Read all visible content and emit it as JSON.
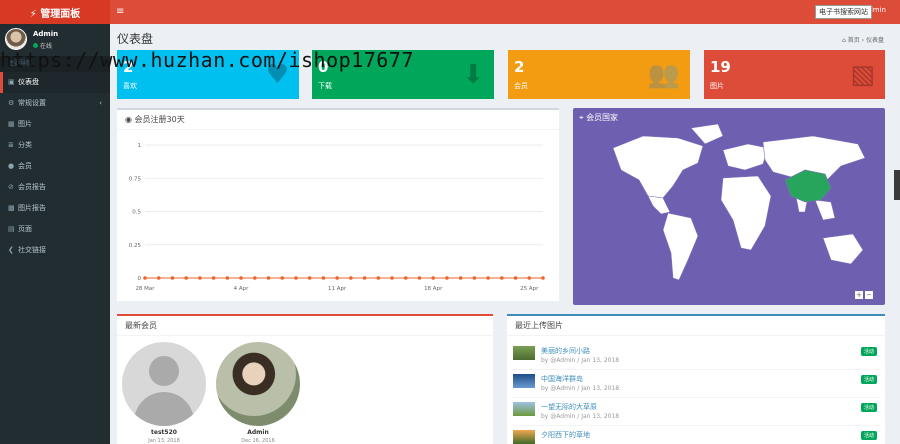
{
  "header": {
    "logo": "⚡ 管理面板",
    "toggle": "≡",
    "user_text": "游览网站 Admin",
    "tooltip": "电子书搜索网站"
  },
  "sidebar": {
    "user": {
      "name": "Admin",
      "status": "在线"
    },
    "nav_header": "主要导航",
    "items": [
      {
        "icon": "▣",
        "label": "仪表盘",
        "active": true
      },
      {
        "icon": "⚙",
        "label": "常规设置",
        "chevron": "‹"
      },
      {
        "icon": "▦",
        "label": "图片"
      },
      {
        "icon": "≣",
        "label": "分类"
      },
      {
        "icon": "●",
        "label": "会员"
      },
      {
        "icon": "⊘",
        "label": "会员报告"
      },
      {
        "icon": "▩",
        "label": "图片报告"
      },
      {
        "icon": "▤",
        "label": "页面"
      },
      {
        "icon": "❮",
        "label": "社交链接"
      }
    ]
  },
  "page": {
    "title": "仪表盘",
    "breadcrumb_home": "⌂ 首页",
    "breadcrumb_sep": "›",
    "breadcrumb_current": "仪表盘"
  },
  "watermark": "https://www.huzhan.com/ishop17677",
  "stats": [
    {
      "value": "2",
      "label": "喜欢",
      "color": "#00c0ef",
      "icon": "♥"
    },
    {
      "value": "0",
      "label": "下载",
      "color": "#00a65a",
      "icon": "⬇"
    },
    {
      "value": "2",
      "label": "会员",
      "color": "#f39c12",
      "icon": "👥"
    },
    {
      "value": "19",
      "label": "图片",
      "color": "#dd4b39",
      "icon": "▧"
    }
  ],
  "chart_panel": {
    "title": "会员注册30天",
    "icon": "◉"
  },
  "chart_data": {
    "type": "line",
    "x": [
      "28 Mar",
      "29 Mar",
      "30 Mar",
      "31 Mar",
      "1 Apr",
      "2 Apr",
      "3 Apr",
      "4 Apr",
      "5 Apr",
      "6 Apr",
      "7 Apr",
      "8 Apr",
      "9 Apr",
      "10 Apr",
      "11 Apr",
      "12 Apr",
      "13 Apr",
      "14 Apr",
      "15 Apr",
      "16 Apr",
      "17 Apr",
      "18 Apr",
      "19 Apr",
      "20 Apr",
      "21 Apr",
      "22 Apr",
      "23 Apr",
      "24 Apr",
      "25 Apr",
      "26 Apr"
    ],
    "series": [
      {
        "values": [
          0,
          0,
          0,
          0,
          0,
          0,
          0,
          0,
          0,
          0,
          0,
          0,
          0,
          0,
          0,
          0,
          0,
          0,
          0,
          0,
          0,
          0,
          0,
          0,
          0,
          0,
          0,
          0,
          0,
          0
        ],
        "color": "#e8662c"
      }
    ],
    "xticks": [
      "28 Mar",
      "4 Apr",
      "11 Apr",
      "18 Apr",
      "25 Apr"
    ],
    "yticks": [
      "0",
      "0.25",
      "0.5",
      "0.75",
      "1"
    ],
    "ylim": [
      0,
      1
    ],
    "grid": true
  },
  "map_panel": {
    "title": "会员国家",
    "icon": "⌖",
    "zoom_in": "+",
    "zoom_out": "−",
    "color_bg": "#6f5fb0",
    "color_land": "#ffffff",
    "color_highlight": "#27a55c"
  },
  "members_panel": {
    "title": "最新会员",
    "members": [
      {
        "name": "test520",
        "date": "Jan 13, 2018"
      },
      {
        "name": "Admin",
        "date": "Dec 16, 2016"
      }
    ]
  },
  "uploads_panel": {
    "title": "最近上传图片",
    "items": [
      {
        "title": "美丽的乡间小路",
        "meta": "by @Admin / Jan 13, 2018",
        "badge": "活动"
      },
      {
        "title": "中国海洋群岛",
        "meta": "by @Admin / Jan 13, 2018",
        "badge": "活动"
      },
      {
        "title": "一望无际的大草原",
        "meta": "by @Admin / Jan 13, 2018",
        "badge": "活动"
      },
      {
        "title": "夕阳西下的草地",
        "meta": "",
        "badge": "活动"
      }
    ]
  }
}
